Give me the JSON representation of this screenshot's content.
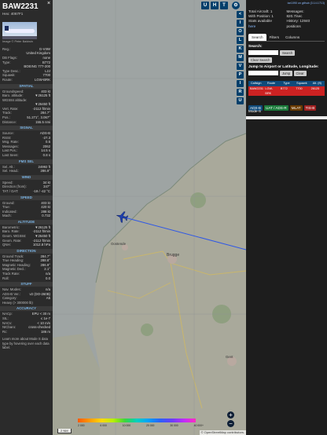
{
  "aircraft": {
    "callsign": "BAW2231",
    "hex_label": "Hex: 4067F1",
    "photo_credit": "Image © Peter Baldwin"
  },
  "info_rows": [
    {
      "k": "Reg.:",
      "v": "G-VIIW"
    },
    {
      "k": "",
      "v": "United Kingdom"
    },
    {
      "k": "DB Flags:",
      "v": "none"
    },
    {
      "k": "Type:",
      "v": "B772"
    },
    {
      "k": "",
      "v": "BOEING 777-200"
    },
    {
      "k": "Type Desc.:",
      "v": "L2J"
    },
    {
      "k": "Squawk:",
      "v": "7700"
    },
    {
      "k": "Route:",
      "v": "LGW-BRK"
    }
  ],
  "sections": [
    {
      "title": "SPATIAL",
      "rows": [
        {
          "k": "Groundspeed:",
          "v": "403 kt"
        },
        {
          "k": "Baro. altitude:",
          "v": "▼26125 ft"
        },
        {
          "k": "WGS84 altitude:",
          "v": ""
        },
        {
          "k": "",
          "v": "▼26450 ft"
        },
        {
          "k": "Vert. Rate:",
          "v": "-2112 ft/min"
        },
        {
          "k": "Track:",
          "v": "284.7°"
        },
        {
          "k": "Pos.:",
          "v": "51.271°, 3.067°"
        },
        {
          "k": "Distance:",
          "v": "155.5 nmi"
        }
      ]
    },
    {
      "title": "SIGNAL",
      "rows": [
        {
          "k": "Source:",
          "v": "ADS-B"
        },
        {
          "k": "RSSI:",
          "v": "-27.3"
        },
        {
          "k": "Msg. Rate:",
          "v": "0.5"
        },
        {
          "k": "Messages:",
          "v": "2062"
        },
        {
          "k": "Last Pos.:",
          "v": "14.5 s"
        },
        {
          "k": "Last Seen:",
          "v": "0.8 s"
        }
      ]
    },
    {
      "title": "FMS SEL",
      "rows": [
        {
          "k": "Sel. Alt.:",
          "v": "24992 ft"
        },
        {
          "k": "Sel. Head.:",
          "v": "286.9°"
        }
      ]
    },
    {
      "title": "WIND",
      "rows": [
        {
          "k": "Speed:",
          "v": "34 kt"
        },
        {
          "k": "Direction (from):",
          "v": "347°"
        },
        {
          "k": "TAT / OAT:",
          "v": "-19 / -42 °C"
        }
      ]
    },
    {
      "title": "SPEED",
      "rows": [
        {
          "k": "Ground:",
          "v": "403 kt"
        },
        {
          "k": "True:",
          "v": "420 kt"
        },
        {
          "k": "Indicated:",
          "v": "288 kt"
        },
        {
          "k": "Mach:",
          "v": "0.732"
        }
      ]
    },
    {
      "title": "ALTITUDE",
      "rows": [
        {
          "k": "Barometric:",
          "v": "▼26125 ft"
        },
        {
          "k": "Baro. Rate:",
          "v": "-2112 ft/min"
        },
        {
          "k": "Geom. WGS84:",
          "v": "▼26450 ft"
        },
        {
          "k": "Geom. Rate:",
          "v": "-2112 ft/min"
        },
        {
          "k": "QNH:",
          "v": "1012.8 hPa"
        }
      ]
    },
    {
      "title": "DIRECTION",
      "rows": [
        {
          "k": "Ground Track:",
          "v": "284.7°"
        },
        {
          "k": "True Heading:",
          "v": "288.8°"
        },
        {
          "k": "Magnetic Heading:",
          "v": "286.9°"
        },
        {
          "k": "Magnetic Decl.:",
          "v": "2.1°"
        },
        {
          "k": "Track Rate:",
          "v": "n/a"
        },
        {
          "k": "Roll:",
          "v": "0.0"
        }
      ]
    },
    {
      "title": "STUFF",
      "rows": [
        {
          "k": "Nav. Modes:",
          "v": "n/a"
        },
        {
          "k": "ADS-B Ver.:",
          "v": "v2 (DO-260B)"
        },
        {
          "k": "Category:",
          "v": "A5"
        },
        {
          "k": "Heavy (> 300000 lb)",
          "v": ""
        }
      ]
    },
    {
      "title": "ACCURACY",
      "rows": [
        {
          "k": "NACp:",
          "v": "EPU < 30 m"
        },
        {
          "k": "SIL:",
          "v": "≤ 1e-7"
        },
        {
          "k": "NACv:",
          "v": "< 10 m/s"
        },
        {
          "k": "NICbaro:",
          "v": "cross-checked"
        },
        {
          "k": "Rc:",
          "v": "186 m"
        }
      ]
    }
  ],
  "footer_text": "Learn more about Mode S data type by hovering over each data label.",
  "map": {
    "top_buttons": [
      "U",
      "H",
      "T"
    ],
    "side_buttons": [
      "<",
      "I",
      "O",
      "L",
      "K",
      "M",
      "V",
      "P",
      "I",
      "R",
      "U"
    ],
    "cities": [
      "Brugge",
      "Oostende",
      "Gent"
    ],
    "scale_label": "2 NM",
    "alt_ticks": [
      "2 000",
      "6 000",
      "10 000",
      "20 000",
      "30 000",
      "40 000+"
    ],
    "attribution": "© OpenStreetMap contributors.",
    "route_color": "#2f58e6"
  },
  "right_panel": {
    "link_text": "tar1090 on github (3.14.1713)",
    "total_label": "Total Aircraft: 1",
    "position_label": "With Position: 1",
    "messages_label": "Messages:",
    "messages_value": "820.7/sec",
    "history_label": "History: 12840 positions",
    "stats_label": "Stats available",
    "stats_link": "here",
    "tabs": [
      "Search",
      "Filters",
      "Columns"
    ],
    "search_label": "Search:",
    "search_button": "Search",
    "clear_search_button": "Clear Search",
    "jump_label": "Jump to Airport or Latitude, Longitude:",
    "jump_button": "Jump",
    "clear_button": "Clear",
    "table_headers": [
      "Callsign",
      "Route",
      "Type",
      "Squawk",
      "Alt. (ft)"
    ],
    "table_row": [
      "BAW2231",
      "LGW-BRK",
      "B772",
      "7700",
      "26125"
    ],
    "filter_chips": [
      {
        "label": "ADS-B",
        "color": "#0f4a7a"
      },
      {
        "label": "UAT / ADS-R",
        "color": "#1a7a3a"
      },
      {
        "label": "MLAT",
        "color": "#6a3a00"
      },
      {
        "label": "TIS-B",
        "color": "#a02020"
      }
    ],
    "mode_s_label": "Mode-S"
  }
}
